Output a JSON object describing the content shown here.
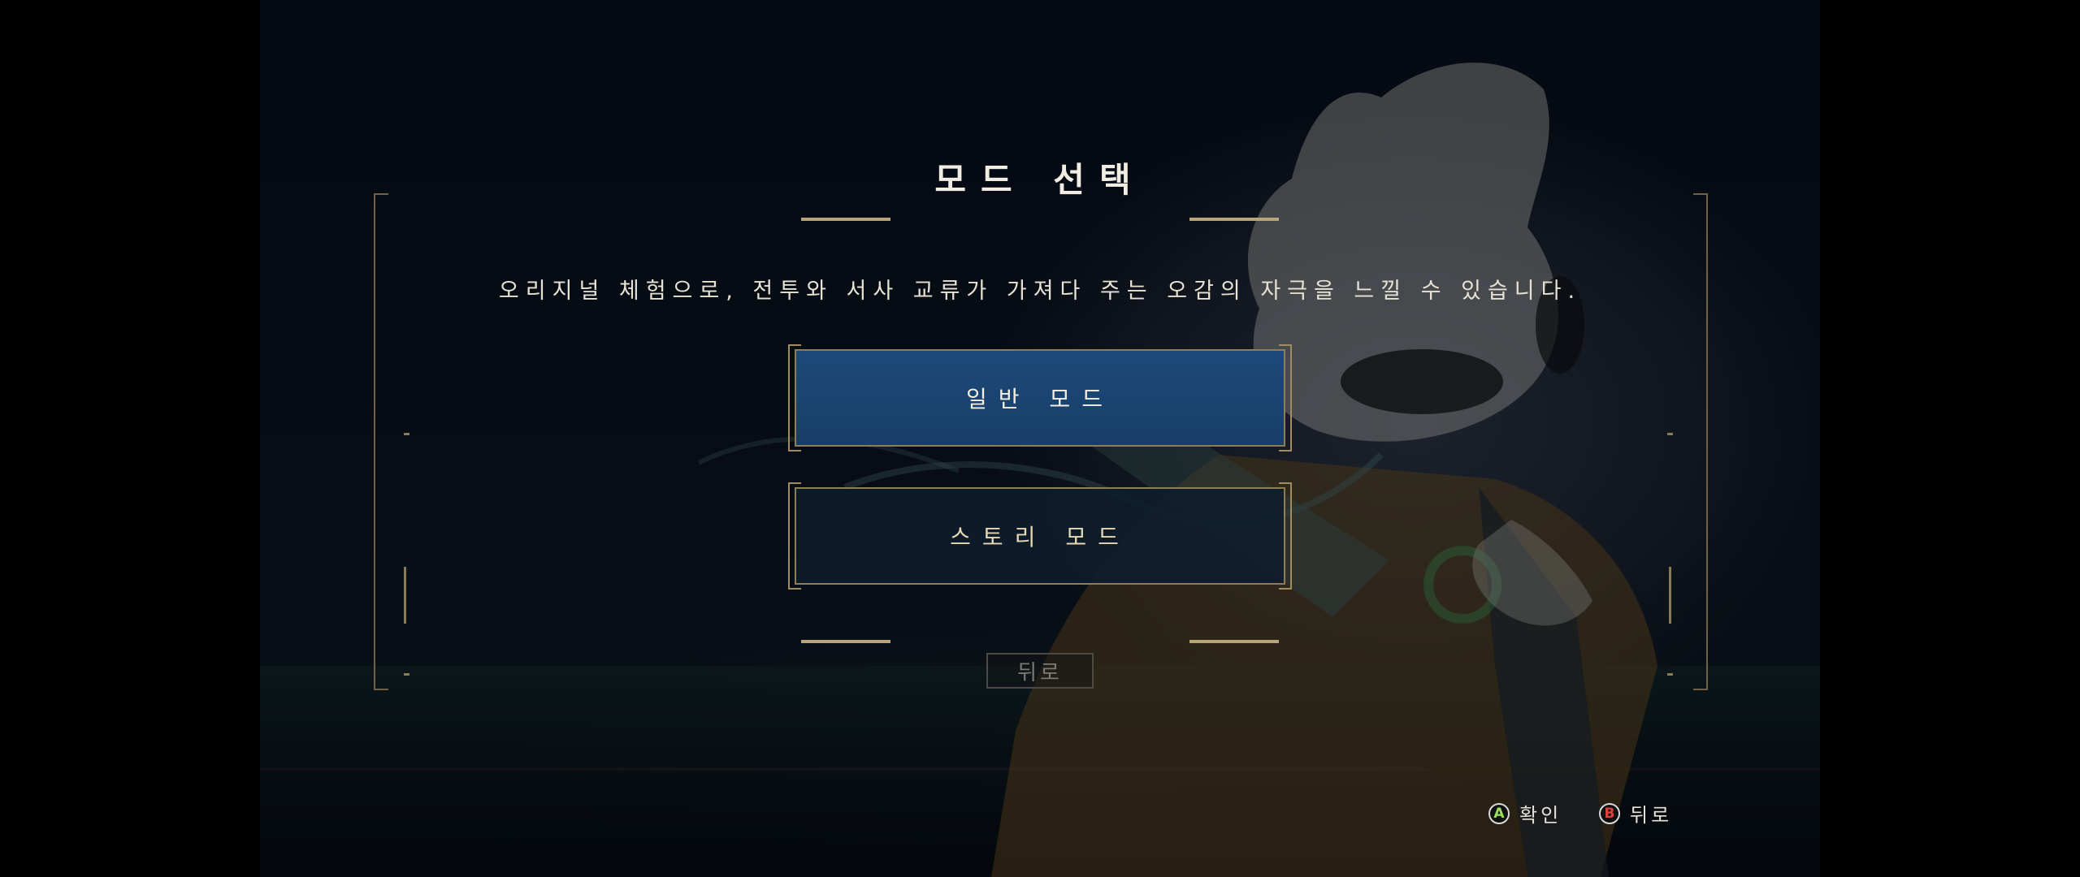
{
  "title": "모드 선택",
  "description": "오리지널 체험으로, 전투와 서사 교류가 가져다 주는 오감의 자극을 느낄 수 있습니다.",
  "modes": [
    {
      "label": "일반 모드",
      "selected": true
    },
    {
      "label": "스토리 모드",
      "selected": false
    }
  ],
  "back_label": "뒤로",
  "prompts": {
    "confirm": {
      "button": "A",
      "label": "확인",
      "color": "#9be15d"
    },
    "back": {
      "button": "B",
      "label": "뒤로",
      "color": "#e0413c"
    }
  },
  "colors": {
    "accent_gold": "#b8a57a",
    "selected_button": "#1d4a7a",
    "unselected_button": "#0e1c2c"
  }
}
